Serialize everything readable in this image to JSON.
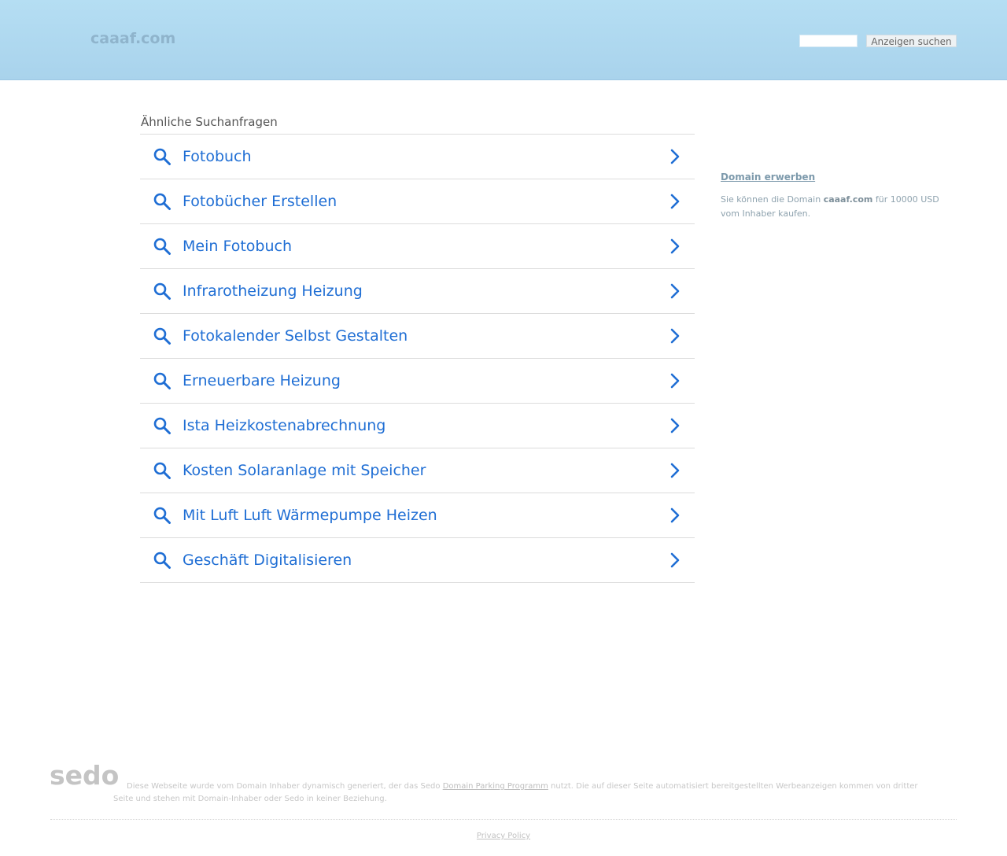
{
  "header": {
    "site_name": "caaaf.com",
    "search": {
      "value": "",
      "button_label": "Anzeigen suchen"
    }
  },
  "related": {
    "heading": "Ähnliche Suchanfragen",
    "items": [
      {
        "label": "Fotobuch"
      },
      {
        "label": "Fotobücher Erstellen"
      },
      {
        "label": "Mein Fotobuch"
      },
      {
        "label": "Infrarotheizung Heizung"
      },
      {
        "label": "Fotokalender Selbst Gestalten"
      },
      {
        "label": "Erneuerbare Heizung"
      },
      {
        "label": "Ista Heizkostenabrechnung"
      },
      {
        "label": "Kosten Solaranlage mit Speicher"
      },
      {
        "label": "Mit Luft Luft Wärmepumpe Heizen"
      },
      {
        "label": "Geschäft Digitalisieren"
      }
    ],
    "icons": {
      "leading": "search-icon",
      "trailing": "chevron-right-icon"
    }
  },
  "sidebar": {
    "title": "Domain erwerben",
    "text_before": "Sie können die Domain ",
    "domain": "caaaf.com",
    "text_after": " für 10000 USD vom Inhaber kaufen."
  },
  "footer": {
    "logo": "sedo",
    "text_before": "Diese Webseite wurde vom Domain Inhaber dynamisch generiert, der das Sedo ",
    "link_label": "Domain Parking Programm",
    "text_after": " nutzt. Die auf dieser Seite automatisiert bereitgestellten Werbeanzeigen kommen von dritter Seite und stehen mit Domain-Inhaber oder Sedo in keiner Beziehung.",
    "privacy_label": "Privacy Policy"
  },
  "colors": {
    "header_bg": "#b5def3",
    "link_blue": "#1f6ed4"
  }
}
